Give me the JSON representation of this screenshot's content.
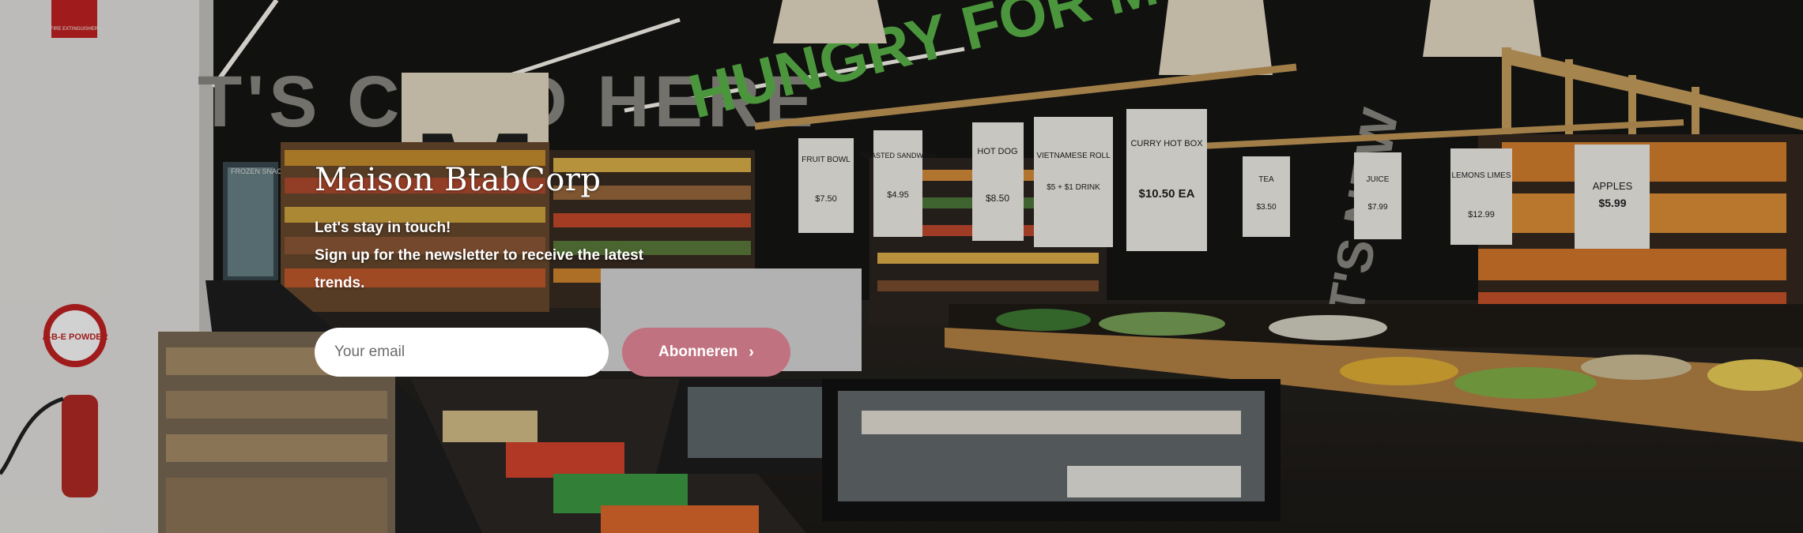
{
  "brand": {
    "name": "Maison BtabCorp"
  },
  "newsletter": {
    "line1": "Let's stay in touch!",
    "line2": "Sign up for the newsletter to receive the latest trends.",
    "email_placeholder": "Your email",
    "subscribe_label": "Abonneren"
  },
  "signs": {
    "wall_left": "T'S COLD HERE",
    "wall_right": "HUNGRY FOR MORE?",
    "side_wall": "IT'S NEW",
    "letter": "M",
    "fire": "FIRE EXTINGUISHER",
    "powder": "A-B-E POWDER",
    "frozen": "FROZEN SNACKS",
    "cards": [
      {
        "name": "FRUIT BOWL",
        "price": "$7.50"
      },
      {
        "name": "ROASTED SANDWICH",
        "price": "$4.95"
      },
      {
        "name": "HOT DOG",
        "price": "$8.50"
      },
      {
        "name": "VIETNAMESE ROLL",
        "price": "$5 + $1 DRINK"
      },
      {
        "name": "CURRY HOT BOX",
        "price": "$10.50 EA"
      },
      {
        "name": "TEA",
        "price": "$3.50"
      },
      {
        "name": "JUICE",
        "price": "$7.99"
      },
      {
        "name": "LEMONS LIMES",
        "price": "$12.99"
      },
      {
        "name": "APPLES",
        "price": "$5.99"
      }
    ]
  },
  "colors": {
    "accent": "#c17280",
    "text": "#ffffff"
  },
  "icons": {
    "subscribe": "chevron-right-icon"
  }
}
